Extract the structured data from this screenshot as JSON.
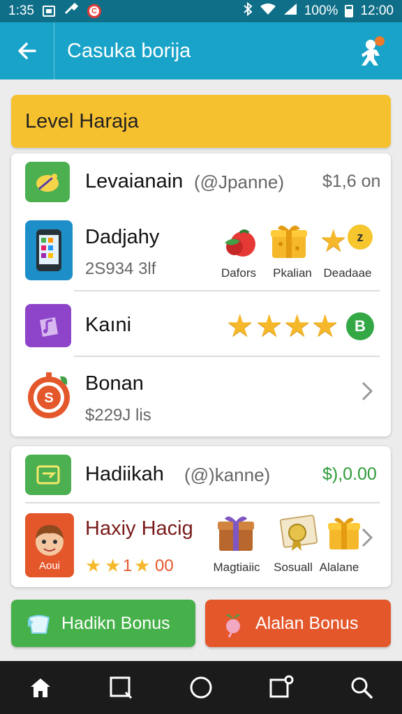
{
  "status_bar": {
    "time": "1:35",
    "battery": "100%",
    "clock": "12:00"
  },
  "app_bar": {
    "title": "Casuka borija"
  },
  "level_header": "Level Haraja",
  "list1": {
    "row1": {
      "name": "Levaianain",
      "handle": "(@Jpanne)",
      "price": "$1,6 on"
    },
    "row2": {
      "name": "Dadjahy",
      "sub": "2S934 3lf",
      "items": [
        "Dafors",
        "Pkalian",
        "Deadaae"
      ]
    },
    "row3": {
      "name": "Kaıni",
      "stars": 4,
      "badge": "B"
    },
    "row4": {
      "name": "Bonan",
      "sub": "$229J lis"
    }
  },
  "list2": {
    "row1": {
      "name": "Hadiikah",
      "handle": "(@)kanne)",
      "price": "$),0.00"
    },
    "row2": {
      "name": "Haxiy Hacig",
      "icon_label": "Aoui",
      "rating": [
        "1",
        "00"
      ],
      "items": [
        "Magtiaiic",
        "Sosuall",
        "Alalane"
      ]
    }
  },
  "buttons": {
    "left": "Hadikn Bonus",
    "right": "Alalan Bonus"
  },
  "colors": {
    "appbar": "#1aa3c8",
    "status": "#0f6f88",
    "header": "#f6c12f",
    "green": "#46b04a",
    "orange": "#e4572b"
  }
}
